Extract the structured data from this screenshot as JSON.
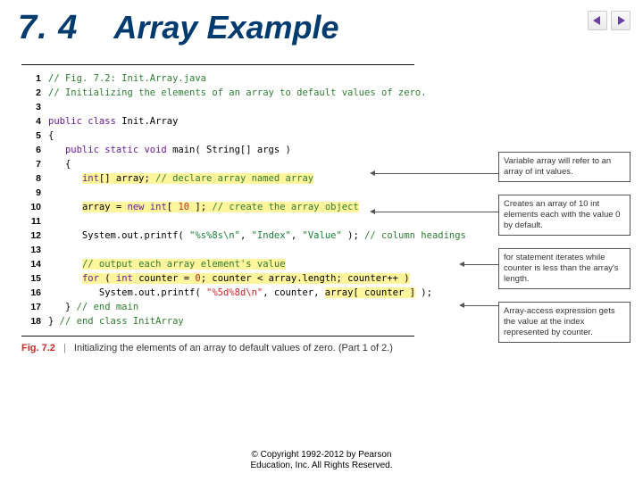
{
  "header": {
    "section_num": "7. 4",
    "title": "Array Example"
  },
  "nav": {
    "prev_icon": "prev-triangle",
    "next_icon": "next-triangle"
  },
  "code": {
    "lines": [
      {
        "n": "1",
        "seg": [
          {
            "t": "// Fig. 7.2: Init.Array.java",
            "cls": "c-comment"
          }
        ]
      },
      {
        "n": "2",
        "seg": [
          {
            "t": "// Initializing the elements of an array to default values of zero.",
            "cls": "c-comment"
          }
        ]
      },
      {
        "n": "3",
        "seg": [
          {
            "t": " ",
            "cls": "c-plain"
          }
        ]
      },
      {
        "n": "4",
        "seg": [
          {
            "t": "public class ",
            "cls": "c-key"
          },
          {
            "t": "Init.Array",
            "cls": "c-plain"
          }
        ]
      },
      {
        "n": "5",
        "seg": [
          {
            "t": "{",
            "cls": "c-plain"
          }
        ]
      },
      {
        "n": "6",
        "seg": [
          {
            "t": "   ",
            "cls": "c-plain"
          },
          {
            "t": "public static void ",
            "cls": "c-key"
          },
          {
            "t": "main( String[] args )",
            "cls": "c-plain"
          }
        ]
      },
      {
        "n": "7",
        "seg": [
          {
            "t": "   {",
            "cls": "c-plain"
          }
        ]
      },
      {
        "n": "8",
        "seg": [
          {
            "t": "      ",
            "cls": "c-plain"
          },
          {
            "t": "int",
            "cls": "c-key",
            "hl": true
          },
          {
            "t": "[] array; ",
            "cls": "c-plain",
            "hl": true
          },
          {
            "t": "// declare array named array",
            "cls": "c-comment",
            "hl": true
          }
        ]
      },
      {
        "n": "9",
        "seg": [
          {
            "t": " ",
            "cls": "c-plain"
          }
        ]
      },
      {
        "n": "10",
        "seg": [
          {
            "t": "      ",
            "cls": "c-plain"
          },
          {
            "t": "array = ",
            "cls": "c-plain",
            "hl": true
          },
          {
            "t": "new int",
            "cls": "c-key",
            "hl": true
          },
          {
            "t": "[ ",
            "cls": "c-plain",
            "hl": true
          },
          {
            "t": "10",
            "cls": "c-str-red",
            "hl": true
          },
          {
            "t": " ]; ",
            "cls": "c-plain",
            "hl": true
          },
          {
            "t": "// create the array object",
            "cls": "c-comment",
            "hl": true
          }
        ]
      },
      {
        "n": "11",
        "seg": [
          {
            "t": " ",
            "cls": "c-plain"
          }
        ]
      },
      {
        "n": "12",
        "seg": [
          {
            "t": "      System.out.printf( ",
            "cls": "c-plain"
          },
          {
            "t": "\"%s%8s\\n\"",
            "cls": "c-str-green"
          },
          {
            "t": ", ",
            "cls": "c-plain"
          },
          {
            "t": "\"Index\"",
            "cls": "c-str-green"
          },
          {
            "t": ", ",
            "cls": "c-plain"
          },
          {
            "t": "\"Value\"",
            "cls": "c-str-green"
          },
          {
            "t": " ); ",
            "cls": "c-plain"
          },
          {
            "t": "// column headings",
            "cls": "c-comment"
          }
        ]
      },
      {
        "n": "13",
        "seg": [
          {
            "t": " ",
            "cls": "c-plain"
          }
        ]
      },
      {
        "n": "14",
        "seg": [
          {
            "t": "      ",
            "cls": "c-plain"
          },
          {
            "t": "// output each array element's value",
            "cls": "c-comment",
            "hl": true
          }
        ]
      },
      {
        "n": "15",
        "seg": [
          {
            "t": "      ",
            "cls": "c-plain"
          },
          {
            "t": "for ",
            "cls": "c-key",
            "hl": true
          },
          {
            "t": "( ",
            "cls": "c-plain",
            "hl": true
          },
          {
            "t": "int ",
            "cls": "c-key",
            "hl": true
          },
          {
            "t": "counter = ",
            "cls": "c-plain",
            "hl": true
          },
          {
            "t": "0",
            "cls": "c-str-red",
            "hl": true
          },
          {
            "t": "; counter < ",
            "cls": "c-plain",
            "hl": true
          },
          {
            "t": "array.length",
            "cls": "c-plain",
            "hl": true
          },
          {
            "t": "; counter++ )",
            "cls": "c-plain",
            "hl": true
          }
        ]
      },
      {
        "n": "16",
        "seg": [
          {
            "t": "         System.out.printf( ",
            "cls": "c-plain"
          },
          {
            "t": "\"%5d%8d\\n\"",
            "cls": "c-str-red"
          },
          {
            "t": ", counter, ",
            "cls": "c-plain"
          },
          {
            "t": "array[ counter ]",
            "cls": "c-plain",
            "hl": true
          },
          {
            "t": " );",
            "cls": "c-plain"
          }
        ]
      },
      {
        "n": "17",
        "seg": [
          {
            "t": "   } ",
            "cls": "c-plain"
          },
          {
            "t": "// end main",
            "cls": "c-comment"
          }
        ]
      },
      {
        "n": "18",
        "seg": [
          {
            "t": "} ",
            "cls": "c-plain"
          },
          {
            "t": "// end class InitArray",
            "cls": "c-comment"
          }
        ]
      }
    ]
  },
  "caption": {
    "label": "Fig. 7.2",
    "text": "Initializing the elements of an array to default values of zero. (Part 1 of 2.)"
  },
  "annotations": [
    "Variable array will refer to an array of int values.",
    "Creates an array of 10 int elements each with the value 0 by default.",
    "for statement iterates while counter is less than the array's length.",
    "Array-access expression gets the value at the index represented by counter."
  ],
  "copyright": {
    "line1": "© Copyright 1992-2012 by Pearson",
    "line2": "Education, Inc. All Rights Reserved."
  }
}
